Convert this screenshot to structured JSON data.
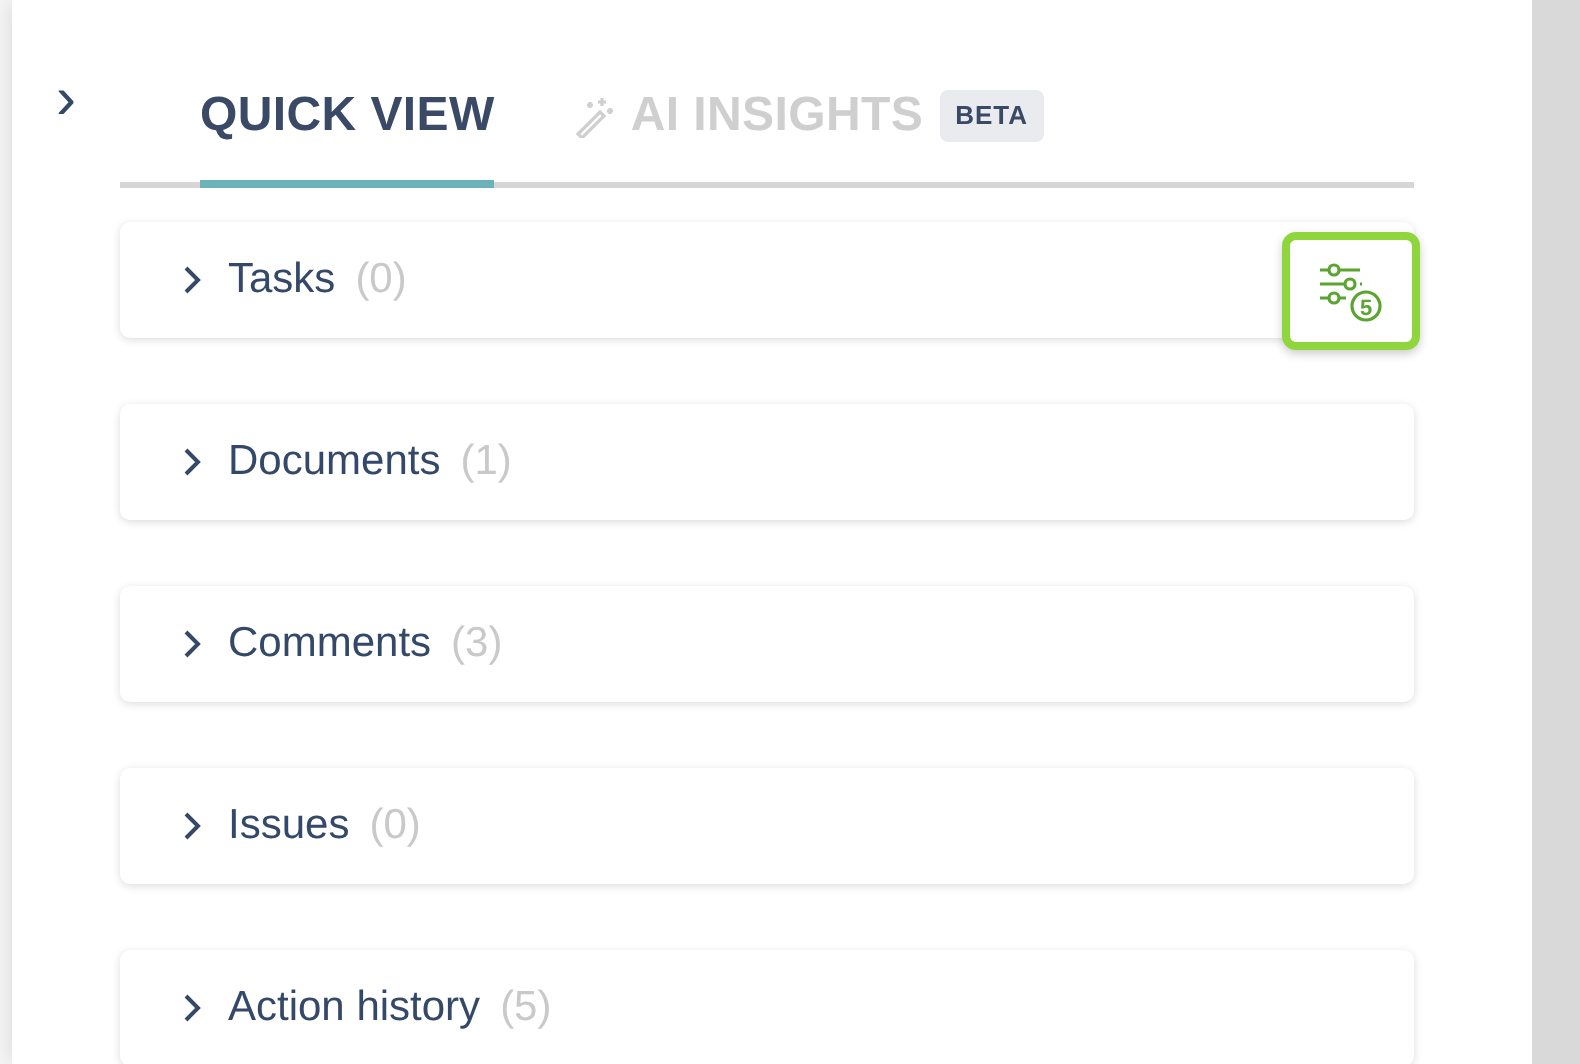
{
  "panel": {
    "collapse_icon": "›"
  },
  "tabs": [
    {
      "label": "QUICK VIEW",
      "selected": true,
      "kind": "plain"
    },
    {
      "label": "AI INSIGHTS",
      "selected": false,
      "kind": "ai",
      "badge": "BETA"
    }
  ],
  "filter": {
    "count": "5",
    "highlighted": true
  },
  "sections": [
    {
      "title": "Tasks",
      "count": "(0)",
      "expanded": false
    },
    {
      "title": "Documents",
      "count": "(1)",
      "expanded": false
    },
    {
      "title": "Comments",
      "count": "(3)",
      "expanded": false
    },
    {
      "title": "Issues",
      "count": "(0)",
      "expanded": false
    },
    {
      "title": "Action history",
      "count": "(5)",
      "expanded": false
    }
  ]
}
